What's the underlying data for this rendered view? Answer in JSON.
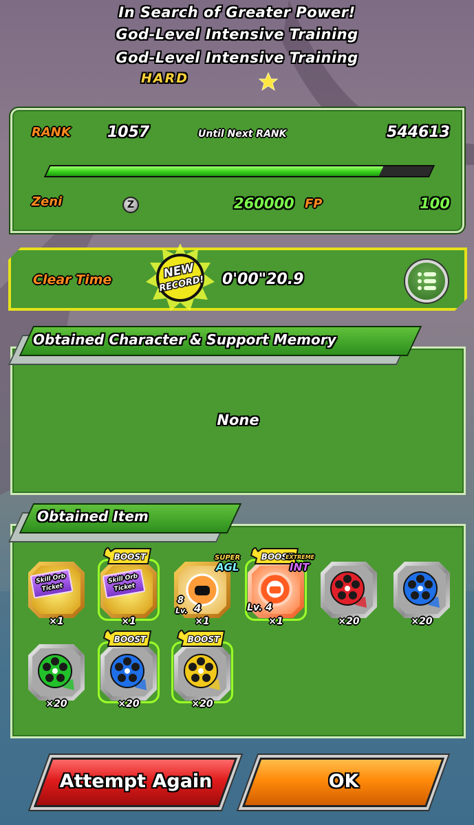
{
  "header": {
    "title_line1": "In Search of Greater Power!",
    "title_line2": "God-Level Intensive Training",
    "title_line3": "God-Level Intensive Training",
    "difficulty": "HARD"
  },
  "rank_panel": {
    "rank_label": "RANK",
    "rank_value": "1057",
    "until_next_label": "Until Next RANK",
    "until_next_value": "544613",
    "exp_progress": 0.87,
    "zeni_label": "Zeni",
    "zeni_icon_glyph": "Z",
    "zeni_value": "260000",
    "fp_label": "FP",
    "fp_value": "100"
  },
  "clear_time": {
    "label": "Clear Time",
    "value": "0'00\"20.9",
    "badge_line1": "NEW",
    "badge_line2": "RECORD!"
  },
  "characters_section": {
    "title": "Obtained Character & Support Memory",
    "empty_text": "None"
  },
  "items_section": {
    "title": "Obtained Item",
    "boost_text": "BOOST",
    "items": [
      {
        "name": "skill-orb-ticket",
        "ticket_text": "Skill Orb Ticket",
        "qty": "×1",
        "boost": false
      },
      {
        "name": "skill-orb-ticket-boost",
        "ticket_text": "Skill Orb Ticket",
        "qty": "×1",
        "boost": true
      },
      {
        "name": "training-item-super-agl",
        "type_top": "SUPER",
        "type_main": "AGL",
        "lv_num": "8",
        "lv_den": "4",
        "lv_label": "Lv.",
        "qty": "×1",
        "boost": false
      },
      {
        "name": "training-item-extreme-int",
        "type_top": "EXTREME",
        "type_main": "INT",
        "lv_label": "Lv. 4",
        "qty": "×1",
        "boost": true
      },
      {
        "name": "film-reel-red",
        "color": "#e0202a",
        "qty": "×20",
        "boost": false
      },
      {
        "name": "film-reel-blue",
        "color": "#1f6fe8",
        "qty": "×20",
        "boost": false
      },
      {
        "name": "film-reel-green",
        "color": "#22c02a",
        "qty": "×20",
        "boost": false
      },
      {
        "name": "film-reel-blue-boost",
        "color": "#1f6fe8",
        "qty": "×20",
        "boost": true
      },
      {
        "name": "film-reel-yellow-boost",
        "color": "#f2c81a",
        "qty": "×20",
        "boost": true
      }
    ]
  },
  "buttons": {
    "attempt_again": "Attempt Again",
    "ok": "OK"
  },
  "colors": {
    "panel_green": "#4a9a31",
    "label_orange": "#ff8a1e",
    "value_green": "#7cff4c",
    "highlight_yellow": "#e6e21a"
  }
}
